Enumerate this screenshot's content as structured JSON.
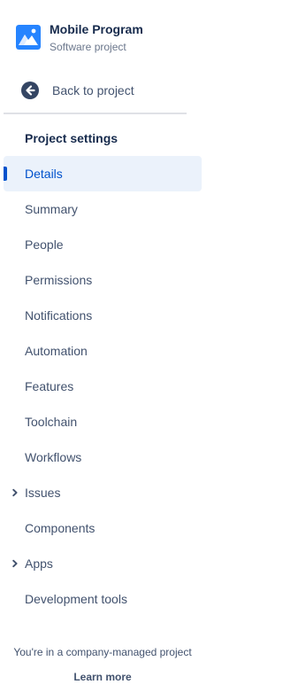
{
  "project": {
    "name": "Mobile Program",
    "type": "Software project",
    "avatar_icon": "mountain-avatar-icon",
    "avatar_color": "#2684ff"
  },
  "back": {
    "label": "Back to project",
    "icon": "arrow-left-circle-icon"
  },
  "settings": {
    "heading": "Project settings",
    "accent_color": "#0052cc",
    "selected_bg": "#ebf2fb",
    "items": [
      {
        "label": "Details",
        "selected": true,
        "expandable": false
      },
      {
        "label": "Summary",
        "selected": false,
        "expandable": false
      },
      {
        "label": "People",
        "selected": false,
        "expandable": false
      },
      {
        "label": "Permissions",
        "selected": false,
        "expandable": false
      },
      {
        "label": "Notifications",
        "selected": false,
        "expandable": false
      },
      {
        "label": "Automation",
        "selected": false,
        "expandable": false
      },
      {
        "label": "Features",
        "selected": false,
        "expandable": false
      },
      {
        "label": "Toolchain",
        "selected": false,
        "expandable": false
      },
      {
        "label": "Workflows",
        "selected": false,
        "expandable": false
      },
      {
        "label": "Issues",
        "selected": false,
        "expandable": true
      },
      {
        "label": "Components",
        "selected": false,
        "expandable": false
      },
      {
        "label": "Apps",
        "selected": false,
        "expandable": true
      },
      {
        "label": "Development tools",
        "selected": false,
        "expandable": false
      }
    ]
  },
  "footer": {
    "text": "You're in a company-managed project",
    "link_label": "Learn more"
  }
}
